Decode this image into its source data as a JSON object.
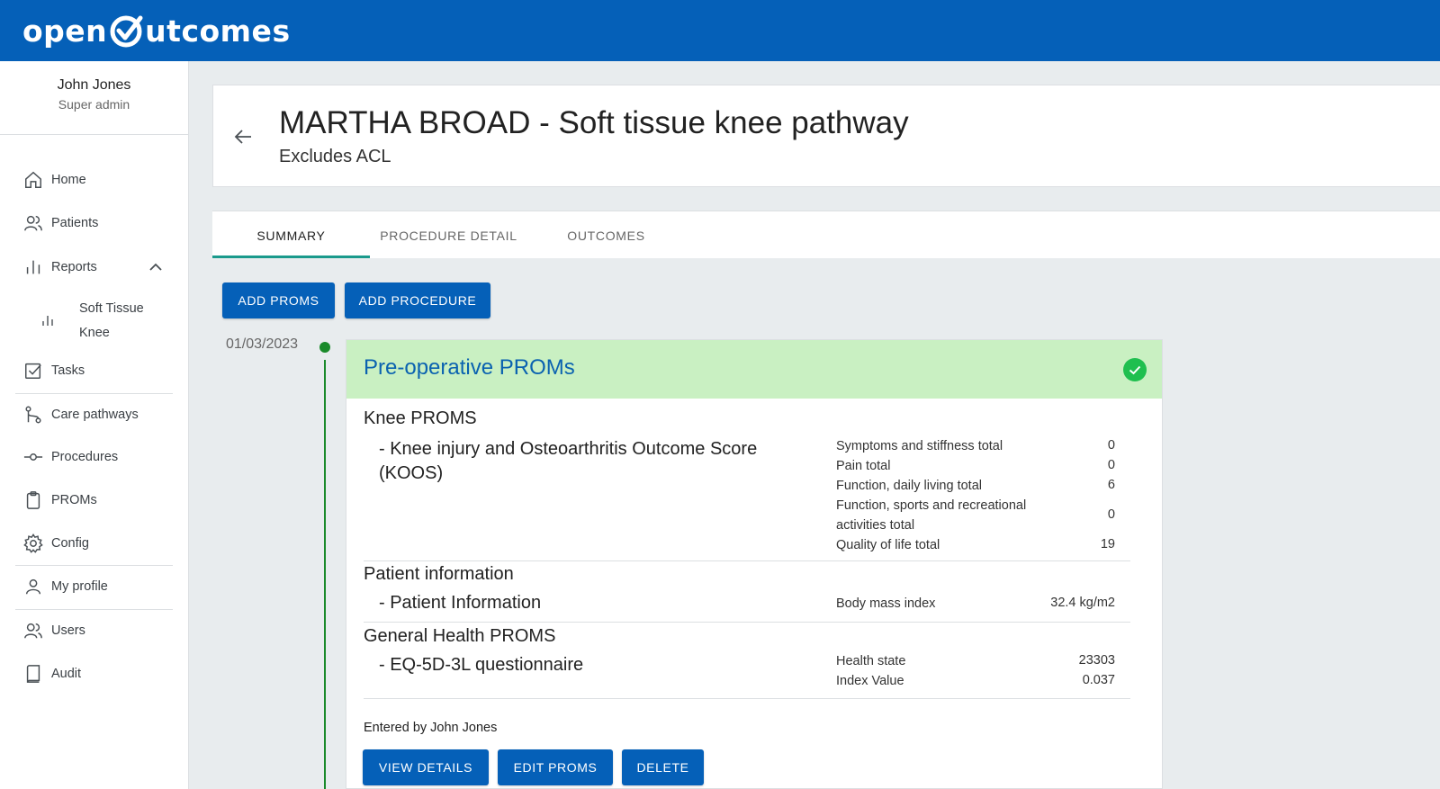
{
  "brand": {
    "logo_left": "open",
    "logo_right": "utcomes",
    "accent": "#0560b8"
  },
  "user": {
    "name": "John Jones",
    "role": "Super admin"
  },
  "nav": {
    "home": "Home",
    "patients": "Patients",
    "reports": "Reports",
    "report_sub": "Soft Tissue Knee",
    "tasks": "Tasks",
    "care_pathways": "Care pathways",
    "procedures": "Procedures",
    "proms": "PROMs",
    "config": "Config",
    "my_profile": "My profile",
    "users": "Users",
    "audit": "Audit"
  },
  "header": {
    "title": "MARTHA BROAD - Soft tissue knee pathway",
    "subtitle": "Excludes ACL"
  },
  "tabs": {
    "summary": "SUMMARY",
    "procedure_detail": "PROCEDURE DETAIL",
    "outcomes": "OUTCOMES",
    "active": "summary"
  },
  "actions": {
    "add_proms": "ADD PROMS",
    "add_procedure": "ADD PROCEDURE"
  },
  "timeline": {
    "date": "01/03/2023",
    "card": {
      "title": "Pre-operative PROMs",
      "status_color": "#1fbf4f",
      "sections": {
        "knee": {
          "title": "Knee PROMS",
          "questionnaire": "- Knee injury and Osteoarthritis Outcome Score (KOOS)",
          "scores": {
            "s1_label": "Symptoms and stiffness total",
            "s1_value": "0",
            "s2_label": "Pain total",
            "s2_value": "0",
            "s3_label": "Function, daily living total",
            "s3_value": "6",
            "s4_label": "Function, sports and recreational activities total",
            "s4_value": "0",
            "s5_label": "Quality of life total",
            "s5_value": "19"
          }
        },
        "patient": {
          "title": "Patient information",
          "questionnaire": "- Patient Information",
          "bmi_label": "Body mass index",
          "bmi_value": "32.4 kg/m2"
        },
        "general": {
          "title": "General Health PROMS",
          "questionnaire": "- EQ-5D-3L questionnaire",
          "health_state_label": "Health state",
          "health_state_value": "23303",
          "index_label": "Index Value",
          "index_value": "0.037"
        }
      },
      "entered_by": "Entered by John Jones",
      "buttons": {
        "view": "VIEW DETAILS",
        "edit": "EDIT PROMS",
        "delete": "DELETE"
      }
    }
  }
}
